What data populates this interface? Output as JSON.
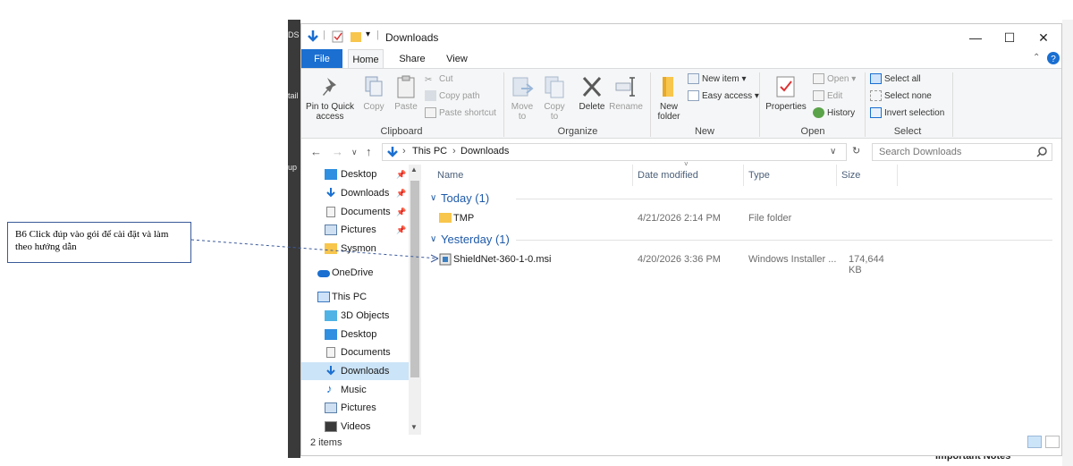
{
  "window": {
    "title": "Downloads"
  },
  "bgstrip": {
    "labels": [
      "DS",
      "tail",
      "up"
    ]
  },
  "background_text": "Important Notes",
  "tabs": [
    "File",
    "Home",
    "Share",
    "View"
  ],
  "ribbon": {
    "clipboard": {
      "label": "Clipboard",
      "pin": "Pin to Quick access",
      "copy": "Copy",
      "paste": "Paste",
      "cut": "Cut",
      "copy_path": "Copy path",
      "paste_shortcut": "Paste shortcut"
    },
    "organize": {
      "label": "Organize",
      "move_to": "Move to",
      "copy_to": "Copy to",
      "delete": "Delete",
      "rename": "Rename"
    },
    "new": {
      "label": "New",
      "new_folder": "New folder",
      "new_item": "New item",
      "easy_access": "Easy access"
    },
    "open": {
      "label": "Open",
      "properties": "Properties",
      "open": "Open",
      "edit": "Edit",
      "history": "History"
    },
    "select": {
      "label": "Select",
      "select_all": "Select all",
      "select_none": "Select none",
      "invert": "Invert selection"
    }
  },
  "address": {
    "crumbs": [
      "This PC",
      "Downloads"
    ],
    "search_placeholder": "Search Downloads"
  },
  "nav": [
    {
      "label": "Desktop",
      "pinned": true
    },
    {
      "label": "Downloads",
      "pinned": true
    },
    {
      "label": "Documents",
      "pinned": true
    },
    {
      "label": "Pictures",
      "pinned": true
    },
    {
      "label": "Sysmon",
      "pinned": false
    },
    {
      "label": "OneDrive"
    },
    {
      "label": "This PC"
    },
    {
      "label": "3D Objects"
    },
    {
      "label": "Desktop"
    },
    {
      "label": "Documents"
    },
    {
      "label": "Downloads",
      "selected": true
    },
    {
      "label": "Music"
    },
    {
      "label": "Pictures"
    },
    {
      "label": "Videos"
    }
  ],
  "columns": [
    "Name",
    "Date modified",
    "Type",
    "Size"
  ],
  "groups": [
    {
      "label": "Today (1)",
      "rows": [
        {
          "name": "TMP",
          "date": "4/21/2026 2:14 PM",
          "type": "File folder",
          "size": ""
        }
      ]
    },
    {
      "label": "Yesterday (1)",
      "rows": [
        {
          "name": "ShieldNet-360-1-0.msi",
          "date": "4/20/2026 3:36 PM",
          "type": "Windows Installer ...",
          "size": "174,644 KB"
        }
      ]
    }
  ],
  "status": "2 items",
  "annotation": "B6 Click đúp vào gói để cài đặt và làm theo hướng dẫn",
  "colors": {
    "accent": "#1a6fd1",
    "selection": "#cce4f7",
    "group_header": "#1e5aa8"
  }
}
